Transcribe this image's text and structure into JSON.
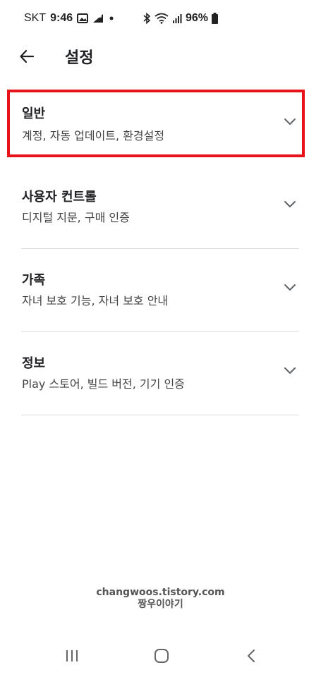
{
  "status_bar": {
    "carrier": "SKT",
    "time": "9:46",
    "battery": "96%",
    "icons": [
      "gallery-icon",
      "data-signal-icon",
      "dot-icon",
      "bluetooth-icon",
      "wifi-icon",
      "cell-signal-icon",
      "battery-icon"
    ]
  },
  "app_bar": {
    "title": "설정",
    "back_icon": "arrow-left-icon"
  },
  "settings": [
    {
      "title": "일반",
      "subtitle": "계정, 자동 업데이트, 환경설정",
      "highlighted": true
    },
    {
      "title": "사용자 컨트롤",
      "subtitle": "디지털 지문, 구매 인증"
    },
    {
      "title": "가족",
      "subtitle": "자녀 보호 기능, 자녀 보호 안내"
    },
    {
      "title": "정보",
      "subtitle": "Play 스토어, 빌드 버전, 기기 인증"
    }
  ],
  "watermark": {
    "line1": "changwoos.tistory.com",
    "line2": "짱우이야기"
  },
  "nav_bar": {
    "icons": [
      "recent-apps-icon",
      "home-icon",
      "back-icon"
    ]
  },
  "colors": {
    "highlight": "#e8121b",
    "divider": "#dadce0",
    "text": "#202124"
  }
}
